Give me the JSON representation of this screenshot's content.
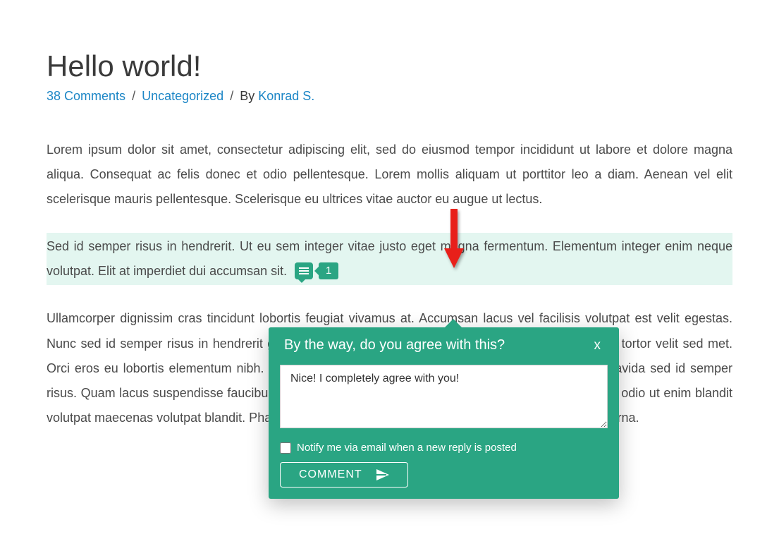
{
  "post": {
    "title": "Hello world!",
    "comments_link": "38 Comments",
    "category": "Uncategorized",
    "byline_prefix": "By",
    "author": "Konrad S."
  },
  "paragraphs": {
    "p1": "Lorem ipsum dolor sit amet, consectetur adipiscing elit, sed do eiusmod tempor incididunt ut labore et dolore magna aliqua. Consequat ac felis donec et odio pellentesque. Lorem mollis aliquam ut porttitor leo a diam. Aenean vel elit scelerisque mauris pellentesque. Scelerisque eu ultrices vitae auctor eu augue ut lectus.",
    "p2": "Sed id semper risus in hendrerit. Ut eu sem integer vitae justo eget magna fermentum. Elementum integer enim neque volutpat. Elit at imperdiet dui accumsan sit.",
    "p3": "Ullamcorper dignissim cras tincidunt lobortis feugiat vivamus at. Accumsan lacus vel facilisis volutpat est velit egestas. Nunc sed id semper risus in hendrerit gravida rutrum quisque. Duis onsectetur lacus feugiat in ante tortor velit sed met. Orci eros eu lobortis elementum nibh. Ultricies mi eget mauris. Sed id semper risus in hendrerit gravida sed id semper risus. Quam lacus suspendisse faucibus interdum posuere lorem ipsum dolor sit amet. Sed vulputate odio ut enim blandit volutpat maecenas volutpat blandit. Pharetra sit amet aliquam id diam feugiat in fermentum posuere urna."
  },
  "inline_comment": {
    "count": "1"
  },
  "popover": {
    "title": "By the way, do you agree with this?",
    "close": "x",
    "reply_text": "Nice! I completely agree with you!",
    "notify_label": "Notify me via email when a new reply is posted",
    "button_label": "COMMENT"
  }
}
